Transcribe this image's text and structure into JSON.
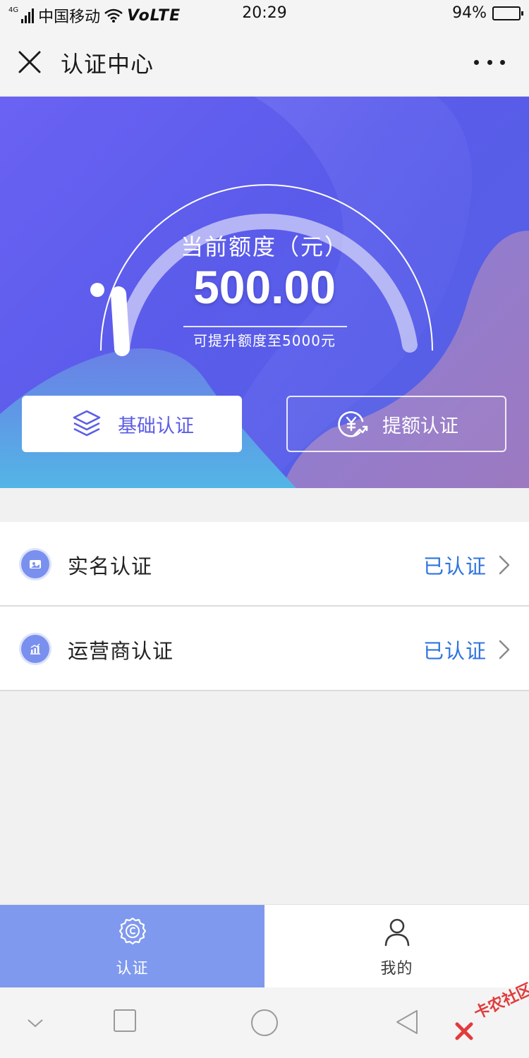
{
  "status_bar": {
    "network_tag": "4G",
    "carrier": "中国移动",
    "volte": "VoLTE",
    "time": "20:29",
    "battery_text": "94%",
    "battery_level": 0.94
  },
  "nav": {
    "title": "认证中心"
  },
  "hero": {
    "label": "当前额度（元）",
    "amount": "500.00",
    "sub": "可提升额度至5000元",
    "buttons": {
      "basic": "基础认证",
      "raise": "提额认证"
    }
  },
  "list": [
    {
      "label": "实名认证",
      "status": "已认证",
      "icon": "id-card-icon"
    },
    {
      "label": "运营商认证",
      "status": "已认证",
      "icon": "chart-icon"
    }
  ],
  "tabs": [
    {
      "label": "认证",
      "icon": "badge-icon",
      "active": true
    },
    {
      "label": "我的",
      "icon": "user-icon",
      "active": false
    }
  ],
  "watermark": "卡农社区",
  "colors": {
    "accent": "#5c5ee6",
    "status_link": "#2f74df",
    "tab_active_bg": "#7f99ee"
  }
}
